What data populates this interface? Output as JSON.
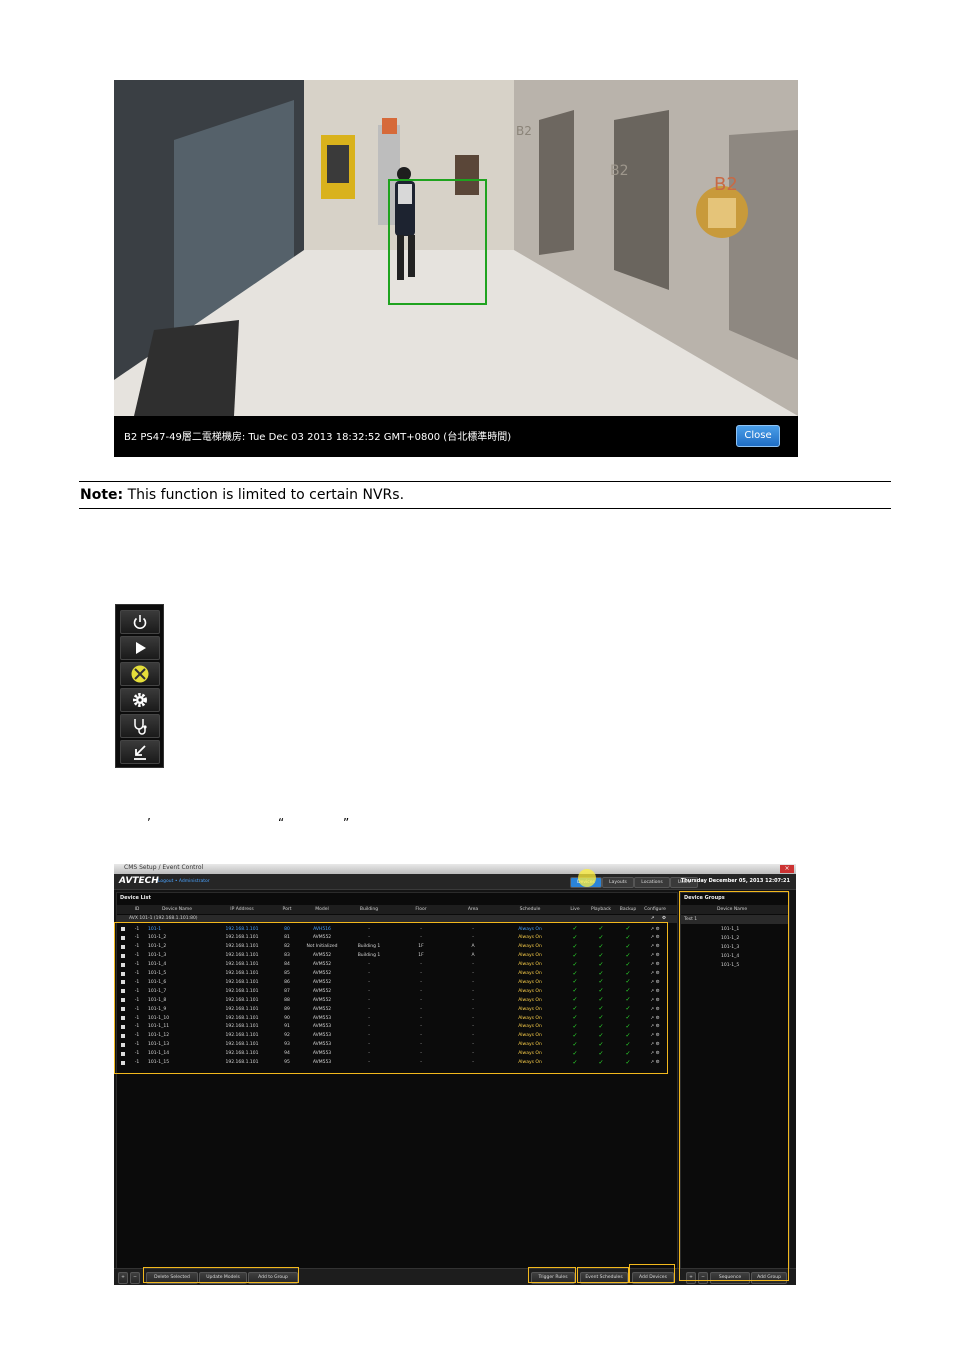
{
  "snapshot": {
    "caption": "B2 PS47-49層二電梯機房: Tue Dec 03 2013 18:32:52 GMT+0800 (台北標準時間)",
    "close_label": "Close",
    "elevator_label_1": "B2",
    "elevator_label_2": "B2",
    "elevator_label_3": "B2"
  },
  "note": {
    "label": "Note:",
    "text": " This function is limited to certain NVRs."
  },
  "icon_bar": {
    "icons": [
      "power-icon",
      "play-icon",
      "setup-tools-icon",
      "gear-icon",
      "stethoscope-icon",
      "download-arrow-icon"
    ]
  },
  "quote_marks": {
    "apostrophe": "’",
    "open_quote": "“",
    "close_quote": "”"
  },
  "setup": {
    "window_title": "CMS Setup / Event Control",
    "logo": "AVTECH",
    "login_info": "Logout  •  Administrator",
    "tabs": [
      "Devices",
      "Layouts",
      "Locations",
      "Users"
    ],
    "datetime": "Thursday December 05, 2013   12:07:21",
    "device_list": {
      "title": "Device List",
      "columns": [
        "ID",
        "Device Name",
        "IP Address",
        "Port",
        "Model",
        "Building",
        "Floor",
        "Area",
        "Schedule",
        "Live",
        "Playback",
        "Backup",
        "Configure"
      ],
      "nvr_row": "AVX  101-1   (192.168.1.101:80)",
      "rows": [
        {
          "id": "-1",
          "name": "101-1",
          "ip": "192.168.1.101",
          "port": "80",
          "model": "AVH516",
          "building": "-",
          "floor": "-",
          "area": "-",
          "schedule": "Always On"
        },
        {
          "id": "-1",
          "name": "101-1_2",
          "ip": "192.168.1.101",
          "port": "81",
          "model": "AVM552",
          "building": "-",
          "floor": "-",
          "area": "-",
          "schedule": "Always On"
        },
        {
          "id": "-1",
          "name": "101-1_2",
          "ip": "192.168.1.101",
          "port": "82",
          "model": "Not Initialized",
          "building": "Building 1",
          "floor": "1F",
          "area": "A",
          "schedule": "Always On"
        },
        {
          "id": "-1",
          "name": "101-1_3",
          "ip": "192.168.1.101",
          "port": "83",
          "model": "AVM552",
          "building": "Building 1",
          "floor": "1F",
          "area": "A",
          "schedule": "Always On"
        },
        {
          "id": "-1",
          "name": "101-1_4",
          "ip": "192.168.1.101",
          "port": "84",
          "model": "AVM552",
          "building": "-",
          "floor": "-",
          "area": "-",
          "schedule": "Always On"
        },
        {
          "id": "-1",
          "name": "101-1_5",
          "ip": "192.168.1.101",
          "port": "85",
          "model": "AVM552",
          "building": "-",
          "floor": "-",
          "area": "-",
          "schedule": "Always On"
        },
        {
          "id": "-1",
          "name": "101-1_6",
          "ip": "192.168.1.101",
          "port": "86",
          "model": "AVM552",
          "building": "-",
          "floor": "-",
          "area": "-",
          "schedule": "Always On"
        },
        {
          "id": "-1",
          "name": "101-1_7",
          "ip": "192.168.1.101",
          "port": "87",
          "model": "AVM552",
          "building": "-",
          "floor": "-",
          "area": "-",
          "schedule": "Always On"
        },
        {
          "id": "-1",
          "name": "101-1_8",
          "ip": "192.168.1.101",
          "port": "88",
          "model": "AVM552",
          "building": "-",
          "floor": "-",
          "area": "-",
          "schedule": "Always On"
        },
        {
          "id": "-1",
          "name": "101-1_9",
          "ip": "192.168.1.101",
          "port": "89",
          "model": "AVM552",
          "building": "-",
          "floor": "-",
          "area": "-",
          "schedule": "Always On"
        },
        {
          "id": "-1",
          "name": "101-1_10",
          "ip": "192.168.1.101",
          "port": "90",
          "model": "AVM553",
          "building": "-",
          "floor": "-",
          "area": "-",
          "schedule": "Always On"
        },
        {
          "id": "-1",
          "name": "101-1_11",
          "ip": "192.168.1.101",
          "port": "91",
          "model": "AVM553",
          "building": "-",
          "floor": "-",
          "area": "-",
          "schedule": "Always On"
        },
        {
          "id": "-1",
          "name": "101-1_12",
          "ip": "192.168.1.101",
          "port": "92",
          "model": "AVM553",
          "building": "-",
          "floor": "-",
          "area": "-",
          "schedule": "Always On"
        },
        {
          "id": "-1",
          "name": "101-1_13",
          "ip": "192.168.1.101",
          "port": "93",
          "model": "AVM553",
          "building": "-",
          "floor": "-",
          "area": "-",
          "schedule": "Always On"
        },
        {
          "id": "-1",
          "name": "101-1_14",
          "ip": "192.168.1.101",
          "port": "94",
          "model": "AVM553",
          "building": "-",
          "floor": "-",
          "area": "-",
          "schedule": "Always On"
        },
        {
          "id": "-1",
          "name": "101-1_15",
          "ip": "192.168.1.101",
          "port": "95",
          "model": "AVM553",
          "building": "-",
          "floor": "-",
          "area": "-",
          "schedule": "Always On"
        }
      ]
    },
    "device_groups": {
      "title": "Device Groups",
      "column": "Device Name",
      "group": "Test 1",
      "items": [
        "101-1_1",
        "101-1_2",
        "101-1_3",
        "101-1_4",
        "101-1_5"
      ]
    },
    "bottom_buttons_left": [
      "Delete Selected",
      "Update Models",
      "Add to Group"
    ],
    "bottom_buttons_right": [
      "Trigger Rules",
      "Event Schedules",
      "Add Devices"
    ],
    "group_buttons": [
      "Sequence",
      "Add Group"
    ],
    "check_mark": "✓",
    "configure_marks": "↗ ⚙"
  },
  "colors": {
    "highlight": "#f2b81d",
    "accent_blue": "#2b84d8",
    "check_green": "#2ee62e",
    "detection_box": "#1fa31f"
  }
}
